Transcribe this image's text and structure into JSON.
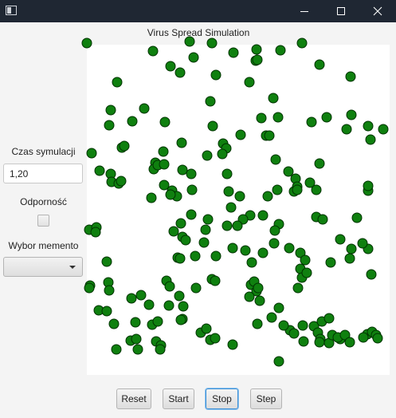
{
  "window": {
    "app_title": "",
    "minimize_icon": "minimize-icon",
    "maximize_icon": "maximize-icon",
    "close_icon": "close-icon"
  },
  "simulation": {
    "title": "Virus Spread Simulation",
    "dot_color": "#0f800f",
    "dot_outline": "#003300",
    "dot_count": 194
  },
  "sidebar": {
    "time_label": "Czas symulacji",
    "time_value": "1,20",
    "immunity_label": "Odporność",
    "immunity_checked": false,
    "memento_label": "Wybor memento",
    "memento_selected": ""
  },
  "controls": {
    "reset_label": "Reset",
    "start_label": "Start",
    "stop_label": "Stop",
    "step_label": "Step",
    "focused": "Stop"
  },
  "colors": {
    "titlebar": "#1f2733",
    "background": "#f4f4f4",
    "focus": "#3b8fd6"
  }
}
